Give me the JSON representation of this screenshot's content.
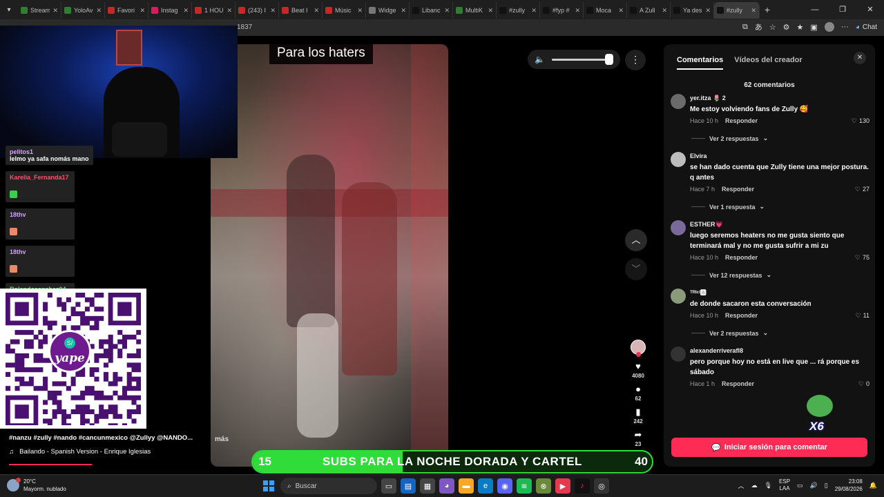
{
  "browser": {
    "tabs": [
      {
        "label": "Stream",
        "color": "#2e7d32"
      },
      {
        "label": "YoloAv",
        "color": "#2e7d32"
      },
      {
        "label": "Favori",
        "color": "#c62828"
      },
      {
        "label": "Instag",
        "color": "#d81b60"
      },
      {
        "label": "1 HOU",
        "color": "#c62828"
      },
      {
        "label": "(243) I",
        "color": "#c62828"
      },
      {
        "label": "Beat I",
        "color": "#c62828"
      },
      {
        "label": "Músic",
        "color": "#c62828"
      },
      {
        "label": "Widge",
        "color": "#777777"
      },
      {
        "label": "Libanc",
        "color": "#111111"
      },
      {
        "label": "MultiK",
        "color": "#2e7d32"
      },
      {
        "label": "#zully",
        "color": "#111111"
      },
      {
        "label": "#fyp #",
        "color": "#111111"
      },
      {
        "label": "Moca",
        "color": "#111111"
      },
      {
        "label": "A Zull",
        "color": "#111111"
      },
      {
        "label": "Ya des",
        "color": "#111111"
      },
      {
        "label": "#zully",
        "color": "#111111"
      }
    ],
    "address_fragment": "1837",
    "chat_label": "Chat"
  },
  "video": {
    "caption": "Para los haters",
    "more_label": "más",
    "volume_level": 0.93,
    "likes": "4080",
    "comments": "62",
    "saves": "242",
    "shares": "23",
    "hashtags": "#nanzu #zully #nando #cancunmexico @Zullyy @NANDO...",
    "music": "Bailando - Spanish Version - Enrique Iglesias",
    "progress": 0.42
  },
  "panel": {
    "tab_comments": "Comentarios",
    "tab_creator": "Vídeos del creador",
    "count": "62 comentarios",
    "comments": [
      {
        "user": "yer.itza 🌷 2",
        "text": "Me estoy volviendo fans de Zully 🥰",
        "time": "Hace 10 h",
        "reply": "Responder",
        "likes": "130",
        "more": "Ver 2 respuestas",
        "avatar": "#6b6b6b"
      },
      {
        "user": "Elvira",
        "text": "se han dado cuenta que Zully tiene una mejor postura. q antes",
        "time": "Hace 7 h",
        "reply": "Responder",
        "likes": "27",
        "more": "Ver 1 respuesta",
        "avatar": "#bdbdbd"
      },
      {
        "user": "ESTHER💗",
        "text": "luego seremos heaters no me gusta siento que terminará mal y no me gusta sufrir a mi zu",
        "time": "Hace 10 h",
        "reply": "Responder",
        "likes": "75",
        "more": "Ver 12 respuestas",
        "avatar": "#7a6a9a"
      },
      {
        "user": "ᵀᴿᴵᶜᴵ🅰",
        "text": "de donde sacaron esta conversación",
        "time": "Hace 10 h",
        "reply": "Responder",
        "likes": "11",
        "more": "Ver 2 respuestas",
        "avatar": "#8a9a7a"
      },
      {
        "user": "alexanderriverafl8",
        "text": "pero porque hoy no está en live que ... rá porque es sábado",
        "time": "Hace 1 h",
        "reply": "Responder",
        "likes": "0",
        "more": "",
        "avatar": "#333333"
      }
    ],
    "login_label": "Iniciar sesión para comentar"
  },
  "stream": {
    "chat": [
      {
        "user": "pelitos1",
        "msg": "lelmo ya safa nomás mano",
        "color": "#e0a0ff",
        "emote": ""
      },
      {
        "user": "Karelia_Fernanda17",
        "msg": "",
        "color": "#ff4d6d",
        "emote": "#3ccf4e"
      },
      {
        "user": "18thv",
        "msg": "",
        "color": "#d0a0ff",
        "emote": "#e88a6a"
      },
      {
        "user": "18thv",
        "msg": "",
        "color": "#d0a0ff",
        "emote": "#e88a6a"
      },
      {
        "user": "Rolandosanchez04",
        "msg": "",
        "color": "#5ee07a",
        "emote": "#c06050"
      }
    ],
    "qr_brand": "yape",
    "qr_symbol": "S/",
    "banner_left": "15",
    "banner_text": "SUBS PARA LA NOCHE DORADA Y CARTEL",
    "banner_right": "40",
    "banner_progress": 0.375,
    "pepe_badge": "X6"
  },
  "taskbar": {
    "temp": "20°C",
    "weather": "Mayorm. nublado",
    "search": "Buscar",
    "lang1": "ESP",
    "lang2": "LAA",
    "time": "23:08",
    "date": "29/08/2026"
  }
}
